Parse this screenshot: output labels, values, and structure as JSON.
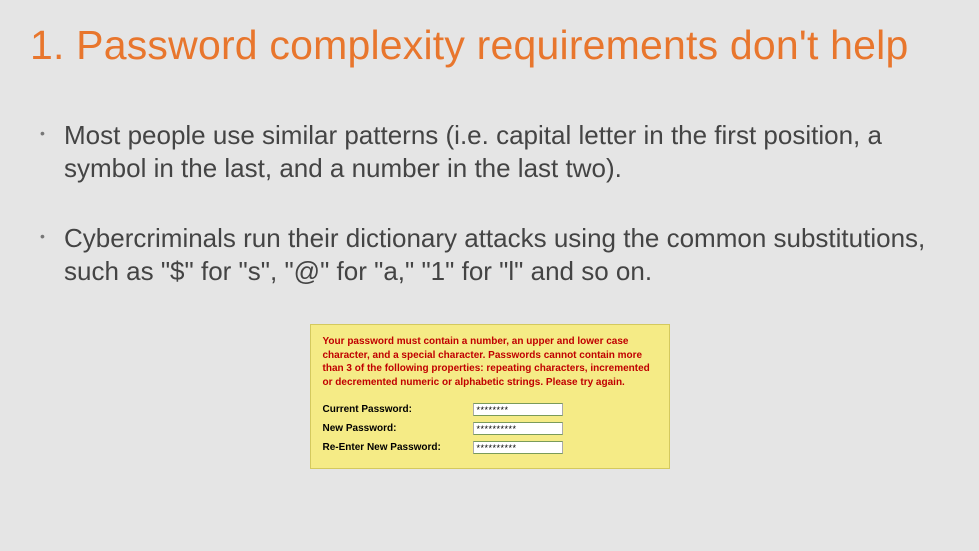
{
  "title": "1. Password complexity requirements don't help",
  "bullets": [
    "Most people use similar patterns (i.e. capital letter in the first position, a symbol in the last, and a number in the last two).",
    "Cybercriminals run their dictionary attacks using the common substitutions, such as \"$\" for \"s\", \"@\" for \"a,\" \"1\" for \"l\" and so on."
  ],
  "form": {
    "error": "Your password must contain a number, an upper and lower case character, and a special character. Passwords cannot contain more than 3 of the following properties: repeating characters, incremented or decremented numeric or alphabetic strings. Please try again.",
    "rows": [
      {
        "label": "Current Password:",
        "value": "********"
      },
      {
        "label": "New Password:",
        "value": "**********"
      },
      {
        "label": "Re-Enter New Password:",
        "value": "**********"
      }
    ]
  }
}
